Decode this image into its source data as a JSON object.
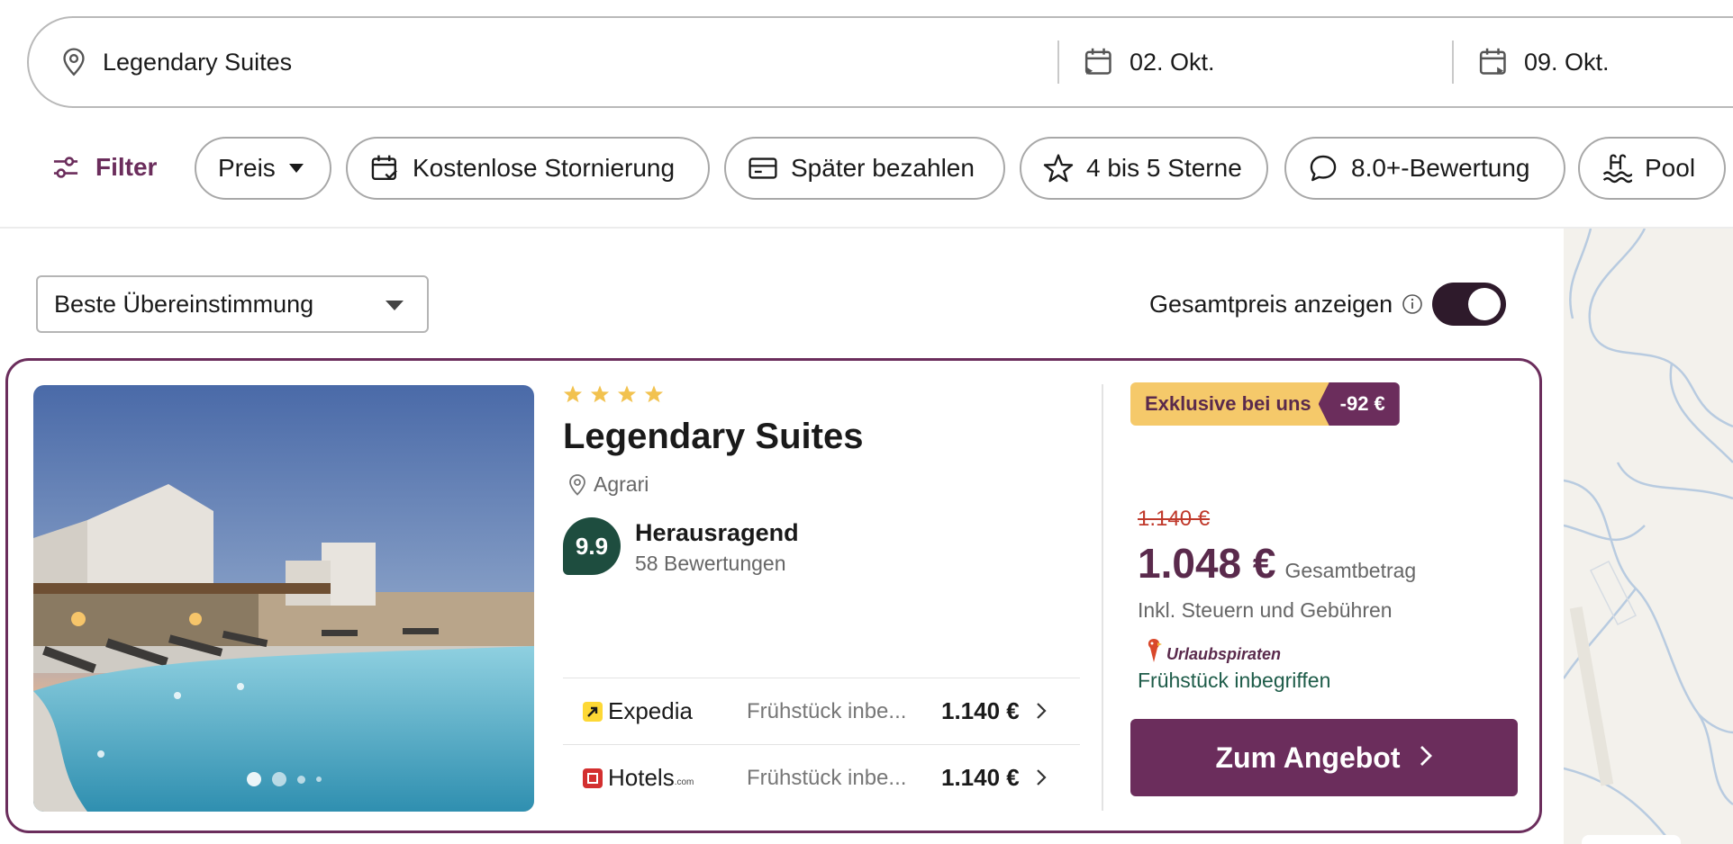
{
  "search": {
    "destination": "Legendary Suites",
    "checkin": "02. Okt.",
    "checkout": "09. Okt."
  },
  "filters": {
    "filter_label": "Filter",
    "chips": [
      {
        "label": "Preis",
        "icon": "caret-down-icon"
      },
      {
        "label": "Kostenlose Stornierung",
        "icon": "calendar-check-icon"
      },
      {
        "label": "Später bezahlen",
        "icon": "credit-card-icon"
      },
      {
        "label": "4 bis 5 Sterne",
        "icon": "star-icon"
      },
      {
        "label": "8.0+-Bewertung",
        "icon": "speech-bubble-icon"
      },
      {
        "label": "Pool",
        "icon": "pool-icon"
      }
    ]
  },
  "sort": {
    "selected": "Beste Übereinstimmung"
  },
  "total_price_toggle": {
    "label": "Gesamtpreis anzeigen",
    "enabled": true
  },
  "hotel": {
    "stars": 4,
    "name": "Legendary Suites",
    "location": "Agrari",
    "score": "9.9",
    "rating_label": "Herausragend",
    "rating_count": "58 Bewertungen",
    "photo_count_dots": 4,
    "providers": [
      {
        "name": "Expedia",
        "desc": "Frühstück inbe...",
        "price": "1.140 €"
      },
      {
        "name": "Hotels",
        "suffix": ".com",
        "desc": "Frühstück inbe...",
        "price": "1.140 €"
      }
    ],
    "badge": {
      "label": "Exklusive bei uns",
      "discount": "-92 €"
    },
    "old_price": "1.140 €",
    "price": "1.048 €",
    "price_label": "Gesamtbetrag",
    "taxes": "Inkl. Steuern und Gebühren",
    "partner": "Urlaubspiraten",
    "breakfast": "Frühstück inbegriffen",
    "cta": "Zum Angebot"
  },
  "colors": {
    "brand": "#6b2d5c",
    "score_bg": "#1e4d3f",
    "badge_yellow": "#f5c96a",
    "old_price": "#c0392b",
    "breakfast": "#1e5c49",
    "star": "#f2c24f"
  }
}
